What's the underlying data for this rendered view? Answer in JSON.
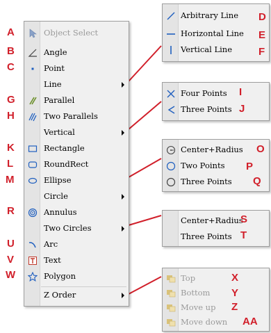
{
  "main_menu": {
    "items": [
      {
        "label": "Object Select",
        "icon": "cursor-icon",
        "disabled": true
      },
      {
        "label": "Angle",
        "icon": "angle-icon"
      },
      {
        "label": "Point",
        "icon": "point-icon"
      },
      {
        "label": "Line",
        "icon": "",
        "submenu": true
      },
      {
        "label": "Parallel",
        "icon": "parallel-icon"
      },
      {
        "label": "Two Parallels",
        "icon": "two-parallels-icon"
      },
      {
        "label": "Vertical",
        "icon": "",
        "submenu": true
      },
      {
        "label": "Rectangle",
        "icon": "rectangle-icon"
      },
      {
        "label": "RoundRect",
        "icon": "roundrect-icon"
      },
      {
        "label": "Ellipse",
        "icon": "ellipse-icon"
      },
      {
        "label": "Circle",
        "icon": "",
        "submenu": true
      },
      {
        "label": "Annulus",
        "icon": "annulus-icon"
      },
      {
        "label": "Two Circles",
        "icon": "",
        "submenu": true
      },
      {
        "label": "Arc",
        "icon": "arc-icon"
      },
      {
        "label": "Text",
        "icon": "text-icon"
      },
      {
        "label": "Polygon",
        "icon": "polygon-icon"
      },
      {
        "label": "Z Order",
        "icon": "",
        "submenu": true
      }
    ]
  },
  "line_submenu": {
    "items": [
      {
        "label": "Arbitrary Line",
        "icon": "diagonal-line-icon"
      },
      {
        "label": "Horizontal Line",
        "icon": "horizontal-line-icon"
      },
      {
        "label": "Vertical Line",
        "icon": "vertical-line-icon"
      }
    ]
  },
  "vertical_submenu": {
    "items": [
      {
        "label": "Four Points",
        "icon": "x-cross-icon"
      },
      {
        "label": "Three Points",
        "icon": "v-check-icon"
      }
    ]
  },
  "circle_submenu": {
    "items": [
      {
        "label": "Center+Radius",
        "icon": "center-circle-icon"
      },
      {
        "label": "Two Points",
        "icon": "circle-icon"
      },
      {
        "label": "Three Points",
        "icon": "circle-icon"
      }
    ]
  },
  "two_circles_submenu": {
    "items": [
      {
        "label": "Center+Radius"
      },
      {
        "label": "Three Points"
      }
    ]
  },
  "zorder_submenu": {
    "items": [
      {
        "label": "Top",
        "icon": "layer-icon",
        "disabled": true
      },
      {
        "label": "Bottom",
        "icon": "layer-icon",
        "disabled": true
      },
      {
        "label": "Move up",
        "icon": "layer-icon",
        "disabled": true
      },
      {
        "label": "Move down",
        "icon": "layer-icon",
        "disabled": true
      }
    ]
  },
  "annotations": {
    "left": [
      "A",
      "B",
      "C",
      "G",
      "H",
      "K",
      "L",
      "M",
      "R",
      "U",
      "V",
      "W"
    ],
    "right": [
      "D",
      "E",
      "F",
      "I",
      "J",
      "O",
      "P",
      "Q",
      "S",
      "T",
      "X",
      "Y",
      "Z",
      "AA"
    ],
    "color": "#d11f2a"
  },
  "colors": {
    "menu_bg": "#f0f0f0",
    "gutter": "#e4e4e4",
    "icon_blue": "#1f5fbf",
    "annotation": "#d11f2a"
  }
}
